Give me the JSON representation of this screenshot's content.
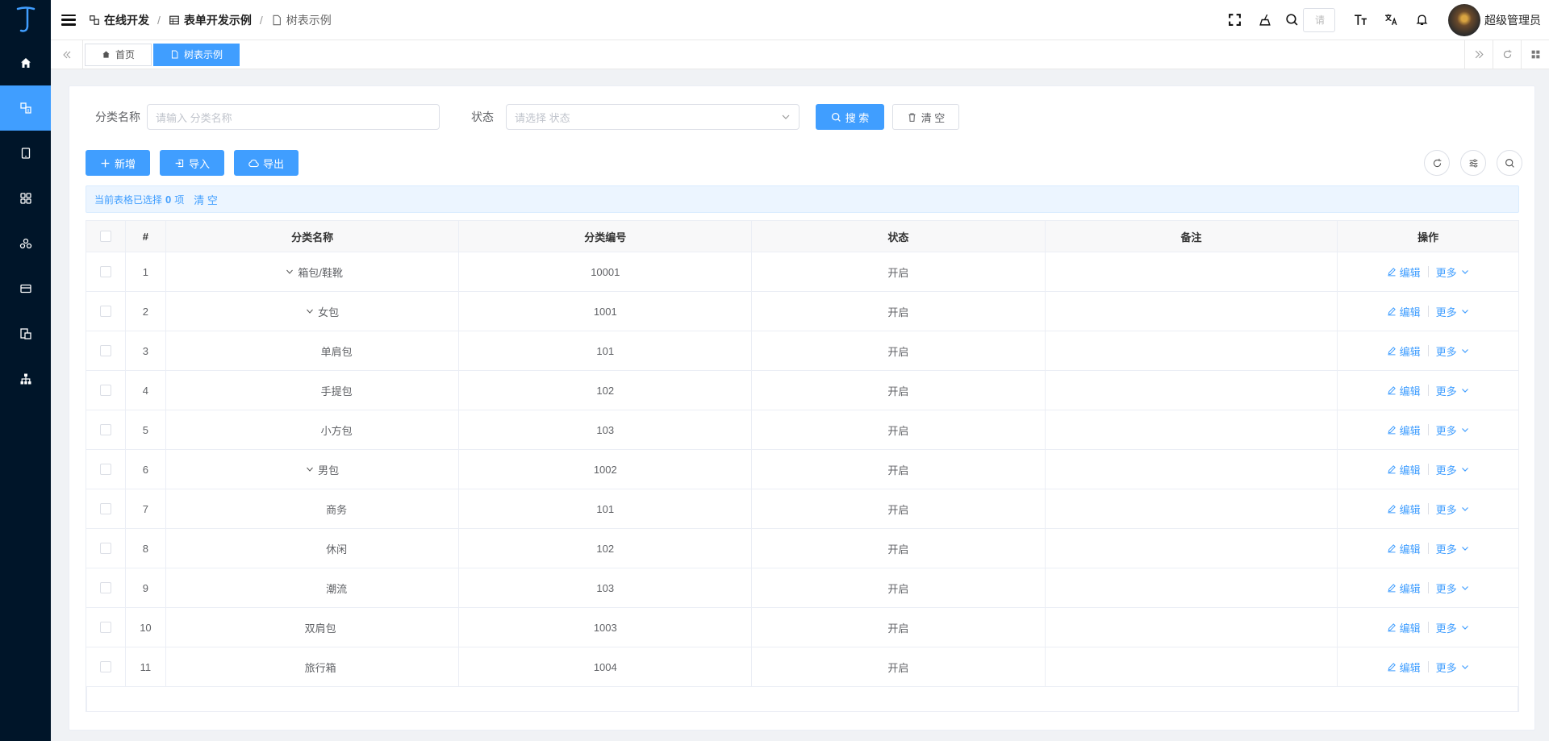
{
  "sidebar": {
    "logo": "J",
    "items": [
      "home-icon",
      "form-dev-icon",
      "tablet-icon",
      "grid-icon",
      "cluster-icon",
      "card-icon",
      "docs-icon",
      "tree-icon"
    ]
  },
  "header": {
    "breadcrumbs": [
      "在线开发",
      "表单开发示例",
      "树表示例"
    ],
    "search_placeholder": "请",
    "username": "超级管理员"
  },
  "tags": {
    "items": [
      {
        "label": "首页",
        "active": false
      },
      {
        "label": "树表示例",
        "active": true
      }
    ]
  },
  "filter": {
    "name_label": "分类名称",
    "name_placeholder": "请输入 分类名称",
    "status_label": "状态",
    "status_placeholder": "请选择 状态",
    "search_button": "搜 索",
    "clear_button": "清 空"
  },
  "toolbar": {
    "add": "新增",
    "import": "导入",
    "export": "导出"
  },
  "selection": {
    "prefix": "当前表格已选择",
    "count": "0",
    "suffix": "项",
    "clear": "清 空"
  },
  "table": {
    "headers": {
      "index": "#",
      "name": "分类名称",
      "code": "分类编号",
      "status": "状态",
      "note": "备注",
      "actions": "操作"
    },
    "edit_label": "编辑",
    "more_label": "更多",
    "rows": [
      {
        "index": "1",
        "name": "箱包/鞋靴",
        "code": "10001",
        "status": "开启",
        "level": 0,
        "expandable": true
      },
      {
        "index": "2",
        "name": "女包",
        "code": "1001",
        "status": "开启",
        "level": 1,
        "expandable": true
      },
      {
        "index": "3",
        "name": "单肩包",
        "code": "101",
        "status": "开启",
        "level": 2,
        "expandable": false
      },
      {
        "index": "4",
        "name": "手提包",
        "code": "102",
        "status": "开启",
        "level": 2,
        "expandable": false
      },
      {
        "index": "5",
        "name": "小方包",
        "code": "103",
        "status": "开启",
        "level": 2,
        "expandable": false
      },
      {
        "index": "6",
        "name": "男包",
        "code": "1002",
        "status": "开启",
        "level": 1,
        "expandable": true
      },
      {
        "index": "7",
        "name": "商务",
        "code": "101",
        "status": "开启",
        "level": 2,
        "expandable": false
      },
      {
        "index": "8",
        "name": "休闲",
        "code": "102",
        "status": "开启",
        "level": 2,
        "expandable": false
      },
      {
        "index": "9",
        "name": "潮流",
        "code": "103",
        "status": "开启",
        "level": 2,
        "expandable": false
      },
      {
        "index": "10",
        "name": "双肩包",
        "code": "1003",
        "status": "开启",
        "level": 0,
        "expandable": false
      },
      {
        "index": "11",
        "name": "旅行箱",
        "code": "1004",
        "status": "开启",
        "level": 0,
        "expandable": false
      }
    ]
  },
  "colors": {
    "primary": "#409eff",
    "sidebar": "#001529"
  }
}
